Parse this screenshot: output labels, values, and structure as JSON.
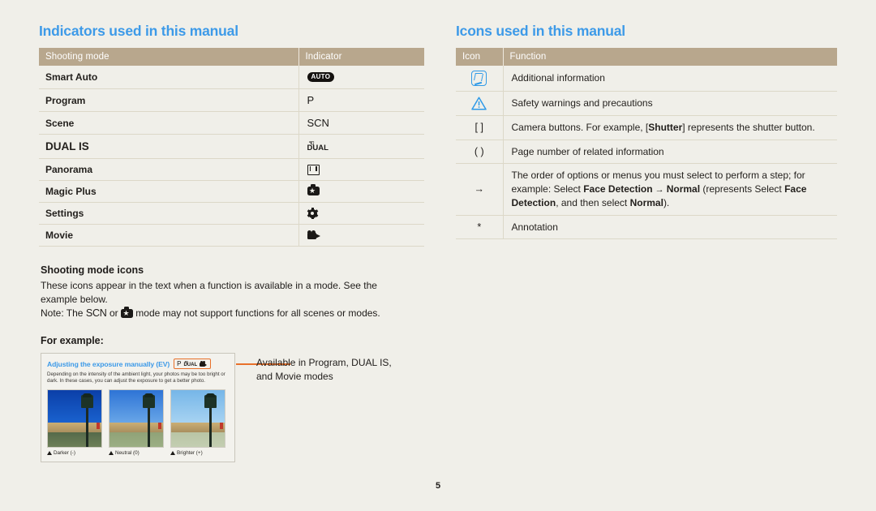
{
  "page": {
    "number": "5",
    "accent_blue": "#3d9ae8",
    "table_header_bg": "#b8a78d",
    "callout_orange": "#e8702a",
    "background": "#f0efe9"
  },
  "left": {
    "title": "Indicators used in this manual",
    "table": {
      "headers": [
        "Shooting mode",
        "Indicator"
      ],
      "rows": [
        {
          "mode": "Smart Auto",
          "indicator_label": "AUTO",
          "icon": "auto-badge-icon"
        },
        {
          "mode": "Program",
          "indicator_label": "P",
          "icon": "program-p-icon"
        },
        {
          "mode": "Scene",
          "indicator_label": "SCN",
          "icon": "scene-scn-icon"
        },
        {
          "mode": "DUAL IS",
          "indicator_label": "DUAL",
          "icon": "dual-is-icon"
        },
        {
          "mode": "Panorama",
          "indicator_label": "",
          "icon": "panorama-filmstrip-icon"
        },
        {
          "mode": "Magic Plus",
          "indicator_label": "",
          "icon": "magic-plus-camera-star-icon"
        },
        {
          "mode": "Settings",
          "indicator_label": "",
          "icon": "settings-gear-icon"
        },
        {
          "mode": "Movie",
          "indicator_label": "",
          "icon": "movie-camera-icon"
        }
      ]
    },
    "shooting_mode_icons": {
      "heading": "Shooting mode icons",
      "paragraph": "These icons appear in the text when a function is available in a mode. See the example below.",
      "note_prefix": "Note: The ",
      "note_scn": "SCN",
      "note_or": " or ",
      "note_suffix": " mode may not support functions for all scenes or modes."
    },
    "for_example_label": "For example:",
    "example_figure": {
      "title": "Adjusting the exposure manually (EV)",
      "mode_badges": [
        "P",
        "dual-is-icon",
        "movie-camera-icon"
      ],
      "description": "Depending on the intensity of the ambient light, your photos may be too bright or dark. In these cases, you can adjust the exposure to get a better photo.",
      "thumbnails": [
        {
          "caption": "Darker (-)"
        },
        {
          "caption": "Neutral (0)"
        },
        {
          "caption": "Brighter (+)"
        }
      ]
    },
    "callout": "Available in Program, DUAL IS, and Movie modes"
  },
  "right": {
    "title": "Icons used in this manual",
    "table": {
      "headers": [
        "Icon",
        "Function"
      ],
      "rows": [
        {
          "icon": "note-pen-icon",
          "icon_label": "",
          "function_parts": [
            {
              "text": "Additional information",
              "bold": false
            }
          ]
        },
        {
          "icon": "warning-triangle-icon",
          "icon_label": "",
          "function_parts": [
            {
              "text": "Safety warnings and precautions",
              "bold": false
            }
          ]
        },
        {
          "icon": "square-brackets-icon",
          "icon_label": "[ ]",
          "function_parts": [
            {
              "text": "Camera buttons. For example, [",
              "bold": false
            },
            {
              "text": "Shutter",
              "bold": true
            },
            {
              "text": "] represents the shutter button.",
              "bold": false
            }
          ]
        },
        {
          "icon": "parentheses-icon",
          "icon_label": "( )",
          "function_parts": [
            {
              "text": "Page number of related information",
              "bold": false
            }
          ]
        },
        {
          "icon": "right-arrow-icon",
          "icon_label": "→",
          "function_parts": [
            {
              "text": "The order of options or menus you must select to perform a step; for example: Select ",
              "bold": false
            },
            {
              "text": "Face Detection",
              "bold": true
            },
            {
              "text": " → ",
              "bold": false
            },
            {
              "text": "Normal",
              "bold": true
            },
            {
              "text": " (represents Select ",
              "bold": false
            },
            {
              "text": "Face Detection",
              "bold": true
            },
            {
              "text": ", and then select ",
              "bold": false
            },
            {
              "text": "Normal",
              "bold": true
            },
            {
              "text": ").",
              "bold": false
            }
          ]
        },
        {
          "icon": "asterisk-icon",
          "icon_label": "*",
          "function_parts": [
            {
              "text": "Annotation",
              "bold": false
            }
          ]
        }
      ]
    }
  }
}
